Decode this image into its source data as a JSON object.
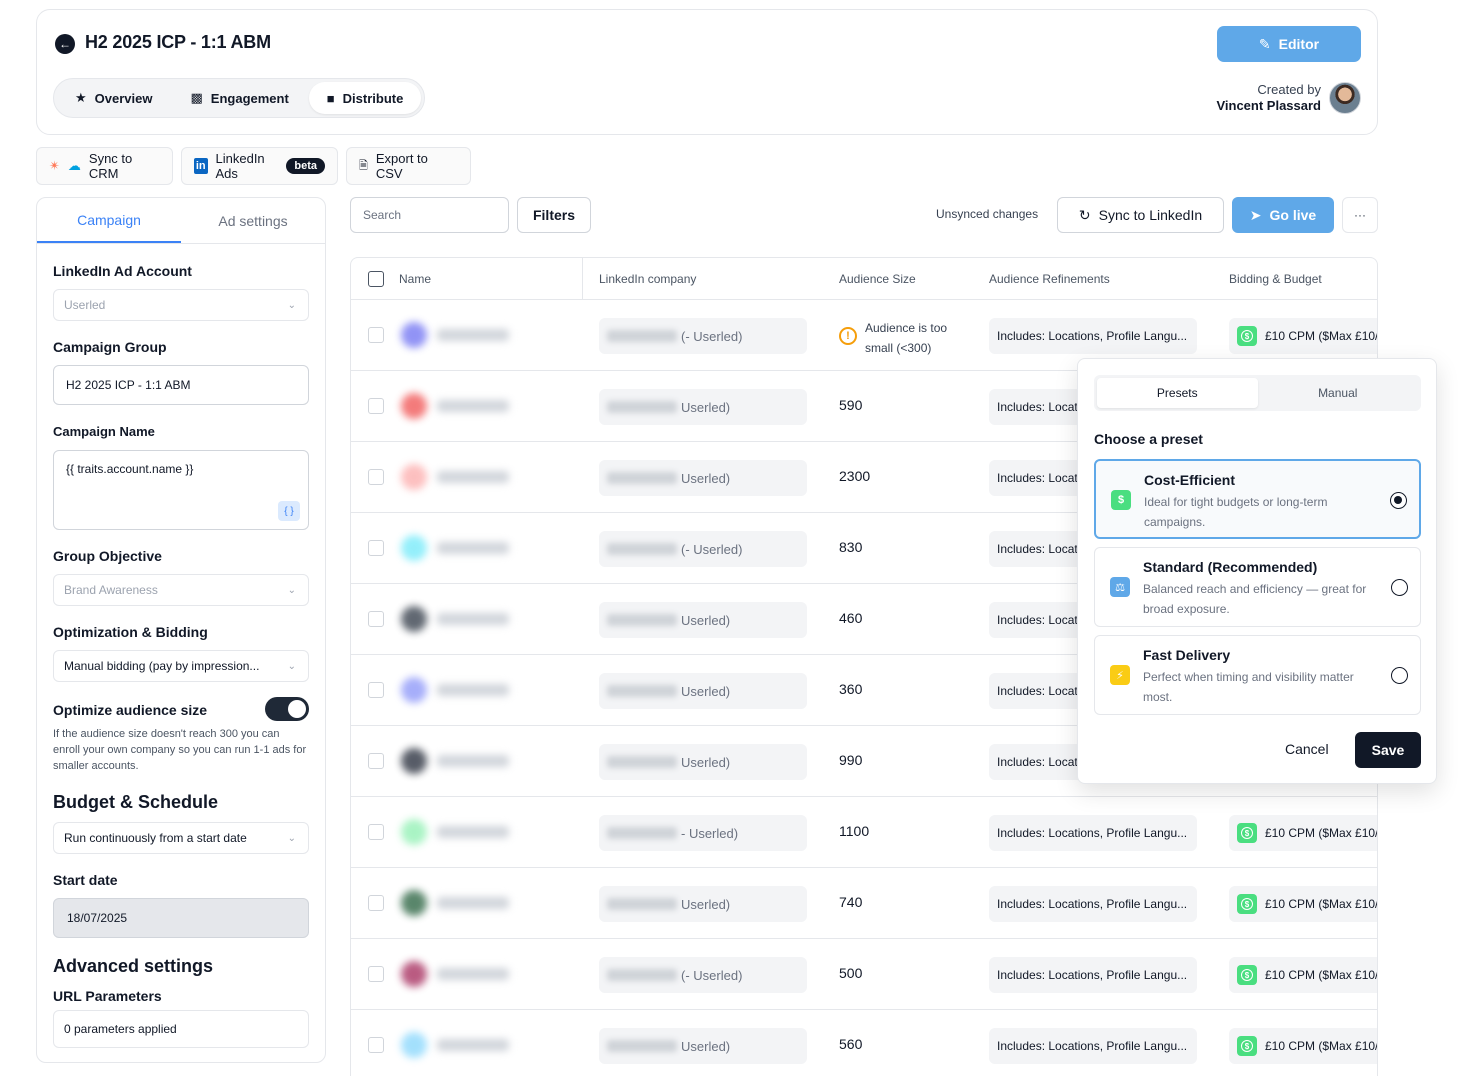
{
  "header": {
    "title": "H2 2025 ICP - 1:1 ABM",
    "tabs": [
      {
        "label": "Overview",
        "icon": "star-icon"
      },
      {
        "label": "Engagement",
        "icon": "bar-chart-icon"
      },
      {
        "label": "Distribute",
        "icon": "bag-icon"
      }
    ],
    "editor_label": "Editor",
    "created_by_label": "Created by",
    "created_by_name": "Vincent Plassard"
  },
  "integrations": {
    "sync_crm": "Sync to CRM",
    "linkedin_ads": "LinkedIn Ads",
    "beta": "beta",
    "export_csv": "Export to CSV"
  },
  "left_panel": {
    "tabs": [
      "Campaign",
      "Ad settings"
    ],
    "ad_account_label": "LinkedIn Ad Account",
    "ad_account_value": "Userled",
    "campaign_group_label": "Campaign Group",
    "campaign_group_value": "H2 2025 ICP - 1:1 ABM",
    "campaign_name_label": "Campaign Name",
    "campaign_name_value": "{{ traits.account.name }}",
    "braces": "{ }",
    "group_objective_label": "Group Objective",
    "group_objective_value": "Brand Awareness",
    "optimization_label": "Optimization & Bidding",
    "optimization_value": "Manual bidding (pay by impression...",
    "optimize_audience_label": "Optimize audience size",
    "optimize_audience_help": "If the audience size doesn't reach 300 you can enroll your own company so you can run 1-1 ads for smaller accounts.",
    "budget_heading": "Budget & Schedule",
    "budget_value": "Run continuously from a start date",
    "start_date_label": "Start date",
    "start_date_value": "18/07/2025",
    "advanced_heading": "Advanced settings",
    "url_params_label": "URL Parameters",
    "url_params_value": "0 parameters applied"
  },
  "toolbar": {
    "search_placeholder": "Search",
    "filters": "Filters",
    "unsynced": "Unsynced changes",
    "sync_linkedin": "Sync to LinkedIn",
    "go_live": "Go live",
    "more": "···"
  },
  "table": {
    "columns": [
      "Name",
      "LinkedIn company",
      "Audience Size",
      "Audience Refinements",
      "Bidding & Budget"
    ],
    "warning_text": "Audience is too small (<300)",
    "rows": [
      {
        "company_suffix": "(- Userled)",
        "audience": "",
        "warning": true,
        "refinement": "Includes: Locations, Profile Langu...",
        "bidding": "£10 CPM ($Max £10/"
      },
      {
        "company_suffix": "Userled)",
        "audience": "590",
        "warning": false,
        "refinement": "Includes: Locat",
        "bidding": ""
      },
      {
        "company_suffix": "Userled)",
        "audience": "2300",
        "warning": false,
        "refinement": "Includes: Locat",
        "bidding": ""
      },
      {
        "company_suffix": "(- Userled)",
        "audience": "830",
        "warning": false,
        "refinement": "Includes: Locat",
        "bidding": ""
      },
      {
        "company_suffix": "Userled)",
        "audience": "460",
        "warning": false,
        "refinement": "Includes: Locat",
        "bidding": ""
      },
      {
        "company_suffix": "Userled)",
        "audience": "360",
        "warning": false,
        "refinement": "Includes: Locat",
        "bidding": ""
      },
      {
        "company_suffix": "Userled)",
        "audience": "990",
        "warning": false,
        "refinement": "Includes: Locat",
        "bidding": ""
      },
      {
        "company_suffix": "- Userled)",
        "audience": "1100",
        "warning": false,
        "refinement": "Includes: Locations, Profile Langu...",
        "bidding": "£10 CPM ($Max £10/"
      },
      {
        "company_suffix": "Userled)",
        "audience": "740",
        "warning": false,
        "refinement": "Includes: Locations, Profile Langu...",
        "bidding": "£10 CPM ($Max £10/"
      },
      {
        "company_suffix": "(- Userled)",
        "audience": "500",
        "warning": false,
        "refinement": "Includes: Locations, Profile Langu...",
        "bidding": "£10 CPM ($Max £10/"
      },
      {
        "company_suffix": "Userled)",
        "audience": "560",
        "warning": false,
        "refinement": "Includes: Locations, Profile Langu...",
        "bidding": "£10 CPM ($Max £10/"
      }
    ]
  },
  "popover": {
    "tabs": [
      "Presets",
      "Manual"
    ],
    "choose_label": "Choose a preset",
    "presets": [
      {
        "title": "Cost-Efficient",
        "description": "Ideal for tight budgets or long-term campaigns.",
        "icon": "dollar-icon",
        "color": "#4ade80",
        "selected": true
      },
      {
        "title": "Standard (Recommended)",
        "description": "Balanced reach and efficiency — great for broad exposure.",
        "icon": "scale-icon",
        "color": "#5fa8e8",
        "selected": false
      },
      {
        "title": "Fast Delivery",
        "description": "Perfect when timing and visibility matter most.",
        "icon": "lightning-icon",
        "color": "#facc15",
        "selected": false
      }
    ],
    "cancel": "Cancel",
    "save": "Save"
  },
  "colors": {
    "accent": "#5fa8e8",
    "dark": "#111827",
    "warning": "#f59e0b",
    "money": "#4ade80"
  }
}
